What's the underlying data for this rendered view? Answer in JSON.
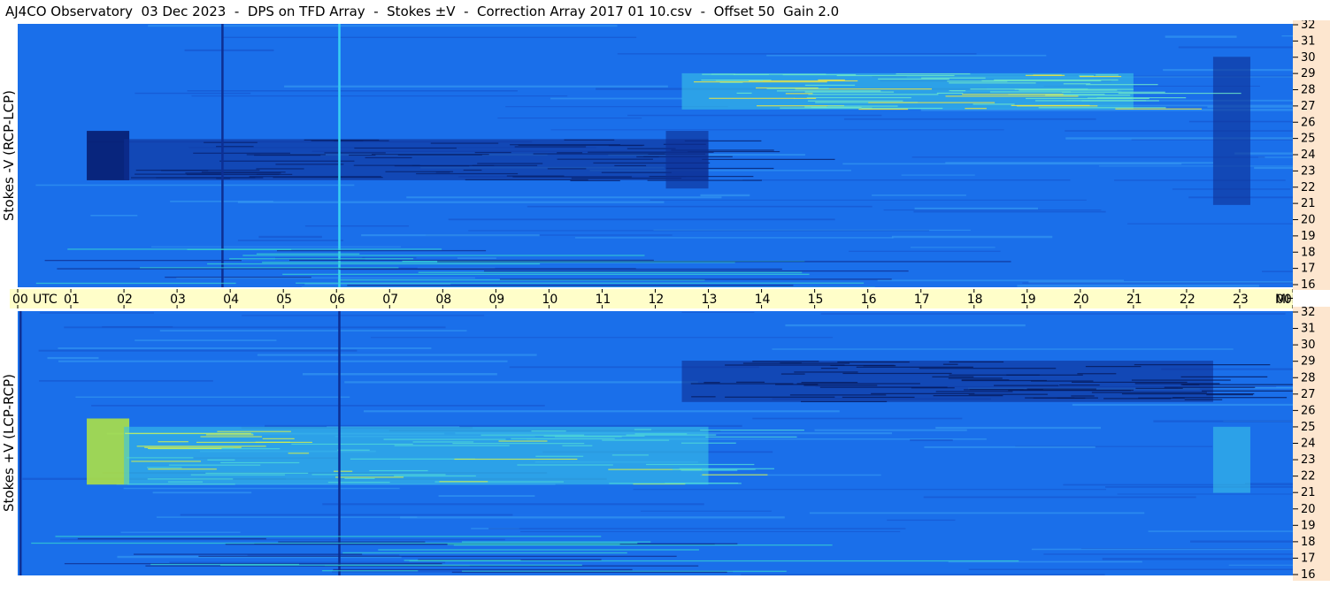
{
  "title": "AJ4CO Observatory  03 Dec 2023  -  DPS on TFD Array  -  Stokes ±V  -  Correction Array 2017 01 10.csv  -  Offset 50  Gain 2.0",
  "panels": {
    "top": {
      "ylabel": "Stokes -V (RCP-LCP)"
    },
    "bottom": {
      "ylabel": "Stokes +V (LCP-RCP)"
    }
  },
  "time_axis": {
    "utc_label": "UTC",
    "unit_label": "MHz",
    "ticks": [
      "00",
      "01",
      "02",
      "03",
      "04",
      "05",
      "06",
      "07",
      "08",
      "09",
      "10",
      "11",
      "12",
      "13",
      "14",
      "15",
      "16",
      "17",
      "18",
      "19",
      "20",
      "21",
      "22",
      "23",
      "00"
    ]
  },
  "freq_axis": {
    "ticks": [
      "32",
      "31",
      "30",
      "29",
      "28",
      "27",
      "26",
      "25",
      "24",
      "23",
      "22",
      "21",
      "20",
      "19",
      "18",
      "17",
      "16"
    ]
  },
  "colors": {
    "background_blue": "#1a6fea",
    "dark_blue": "#0a2a86",
    "cyan": "#2fc6ee",
    "green_yellow": "#b4e83c",
    "time_band": "#fffec9",
    "freq_band": "#fde6cf"
  },
  "chart_data": [
    {
      "type": "heatmap",
      "title": "Stokes -V (RCP-LCP)",
      "x_range_utc_hours": [
        0,
        24
      ],
      "y_range_mhz": [
        16,
        32
      ],
      "features": [
        {
          "hours": [
            1.3,
            2.1
          ],
          "mhz": [
            22.5,
            25.5
          ],
          "level": "very dark"
        },
        {
          "hours": [
            2.0,
            13.0
          ],
          "mhz": [
            22.5,
            25.0
          ],
          "level": "dark"
        },
        {
          "hours": [
            12.2,
            13.0
          ],
          "mhz": [
            22.0,
            25.5
          ],
          "level": "dark"
        },
        {
          "hours": [
            22.5,
            23.2
          ],
          "mhz": [
            21.0,
            30.0
          ],
          "level": "dark"
        },
        {
          "hours": [
            12.5,
            21.0
          ],
          "mhz": [
            26.8,
            29.0
          ],
          "level": "bright"
        }
      ],
      "lines": [
        {
          "hour": 3.85,
          "level": "dark"
        },
        {
          "hour": 6.05,
          "level": "cyan"
        }
      ]
    },
    {
      "type": "heatmap",
      "title": "Stokes +V (LCP-RCP)",
      "x_range_utc_hours": [
        0,
        24
      ],
      "y_range_mhz": [
        16,
        32
      ],
      "features": [
        {
          "hours": [
            1.3,
            2.1
          ],
          "mhz": [
            21.5,
            25.5
          ],
          "level": "very bright"
        },
        {
          "hours": [
            2.0,
            13.0
          ],
          "mhz": [
            21.5,
            25.0
          ],
          "level": "bright"
        },
        {
          "hours": [
            22.5,
            23.2
          ],
          "mhz": [
            21.0,
            25.0
          ],
          "level": "bright"
        },
        {
          "hours": [
            12.5,
            22.5
          ],
          "mhz": [
            26.5,
            29.0
          ],
          "level": "dark"
        }
      ],
      "lines": [
        {
          "hour": 0.05,
          "level": "dark"
        },
        {
          "hour": 6.05,
          "level": "dark"
        }
      ]
    }
  ]
}
